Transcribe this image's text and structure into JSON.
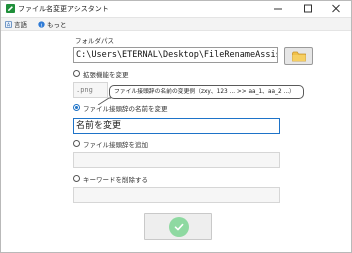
{
  "window": {
    "title": "ファイル名変更アシスタント"
  },
  "menu": {
    "language_label": "言語",
    "about_label": "もっと"
  },
  "folder_path": {
    "label": "フォルダパス",
    "value": "C:\\Users\\ETERNAL\\Desktop\\FileRenameAssistant"
  },
  "options": {
    "change_extension": {
      "label": "拡張機能を変更",
      "checked": false,
      "value": ".png"
    },
    "tooltip": "ファイル接頭辞の名前の変更例（zxy、123 ... >> aa_1、aa_2 ...）",
    "change_prefix": {
      "label": "ファイル接頭辞の名前を変更",
      "checked": true,
      "placeholder": "名前を変更"
    },
    "add_prefix": {
      "label": "ファイル接頭辞を追加",
      "checked": false,
      "value": ""
    },
    "remove_keyword": {
      "label": "キーワードを削除する",
      "checked": false,
      "value": ""
    }
  },
  "colors": {
    "accent": "#1e73c8",
    "app_icon": "#1f8f3a",
    "ok_button": "#8ed9a1"
  },
  "icons": {
    "app": "edit-icon",
    "language": "globe-icon",
    "about": "info-icon",
    "browse": "folder-icon",
    "ok": "check-icon"
  }
}
